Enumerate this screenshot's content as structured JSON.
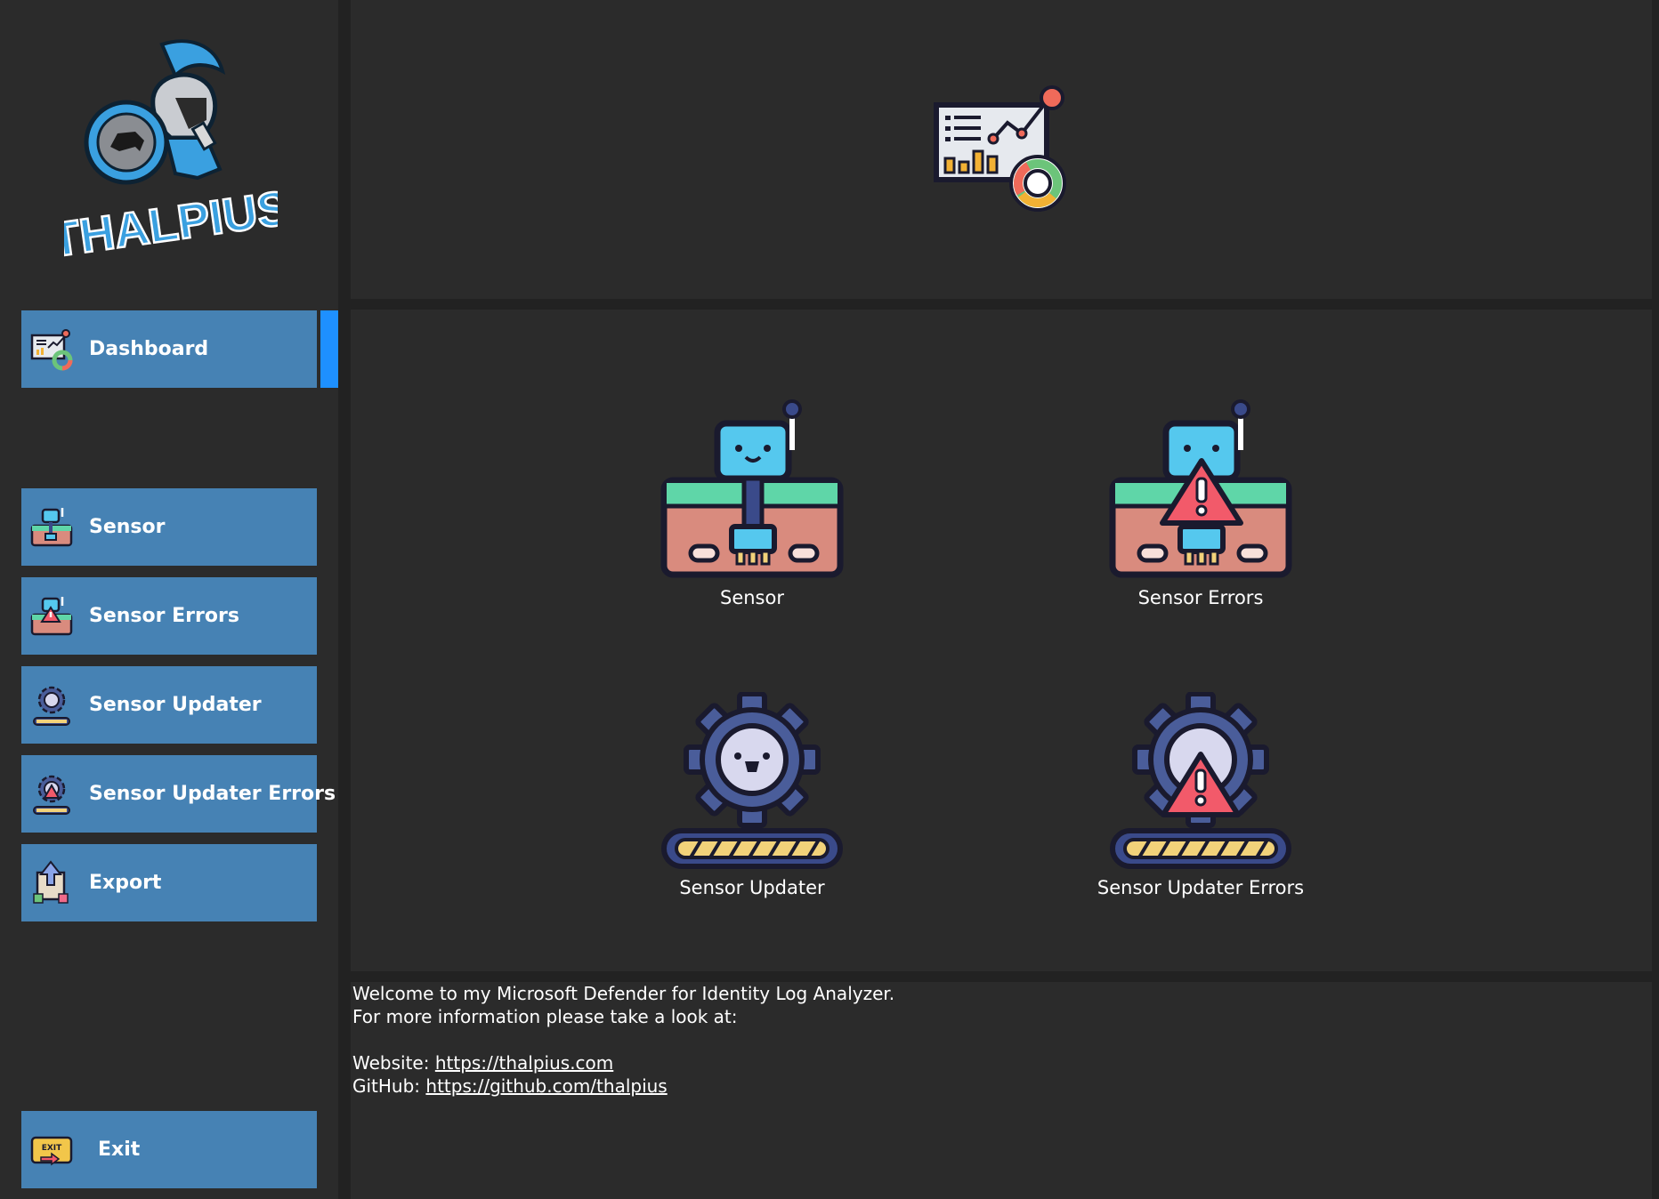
{
  "app": {
    "logo_text": "THALPIUS"
  },
  "sidebar": {
    "items": [
      {
        "label": "Dashboard",
        "icon": "dashboard-icon",
        "active": true
      },
      {
        "label": "Sensor",
        "icon": "sensor-robot-icon"
      },
      {
        "label": "Sensor Errors",
        "icon": "sensor-error-icon"
      },
      {
        "label": "Sensor Updater",
        "icon": "gear-icon"
      },
      {
        "label": "Sensor Updater Errors",
        "icon": "gear-error-icon"
      },
      {
        "label": "Export",
        "icon": "export-icon"
      }
    ],
    "exit_label": "Exit",
    "exit_icon": "exit-sign-icon"
  },
  "header": {
    "icon": "analytics-dashboard-icon"
  },
  "tiles": [
    {
      "label": "Sensor",
      "icon": "sensor-robot-icon"
    },
    {
      "label": "Sensor Errors",
      "icon": "sensor-error-icon"
    },
    {
      "label": "Sensor Updater",
      "icon": "gear-progress-icon"
    },
    {
      "label": "Sensor Updater Errors",
      "icon": "gear-progress-error-icon"
    }
  ],
  "info": {
    "line1": "Welcome to my Microsoft Defender for Identity Log Analyzer.",
    "line2": "For more information please take a look at:",
    "website_label": "Website: ",
    "website_url": "https://thalpius.com",
    "github_label": "GitHub: ",
    "github_url": "https://github.com/thalpius"
  },
  "colors": {
    "background": "#2b2b2b",
    "divider": "#222222",
    "nav_button": "#4682b4",
    "active_indicator": "#1e90ff",
    "text": "#ffffff"
  }
}
